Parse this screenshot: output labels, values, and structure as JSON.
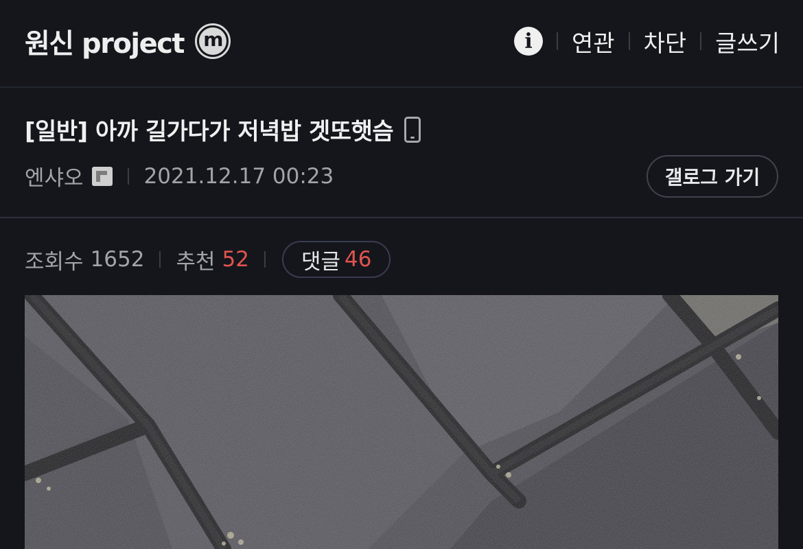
{
  "header": {
    "gallery_name": "원신 project",
    "minor_badge": "m",
    "info_icon": "info-icon",
    "actions": [
      "연관",
      "차단",
      "글쓰기"
    ]
  },
  "post": {
    "title": "[일반] 아까 길가다가 저녁밥 겟또햇슴",
    "device_icon": "mobile-phone-icon",
    "author": "엔샤오",
    "author_icon": "fixed-nickname-icon",
    "datetime": "2021.12.17 00:23",
    "gallog_label": "갤로그 가기"
  },
  "stats": {
    "views_label": "조회수",
    "views": "1652",
    "recommend_label": "추천",
    "recommend": "52",
    "comments_label": "댓글",
    "comments": "46"
  },
  "colors": {
    "background": "#14161b",
    "accent_red": "#e0544f"
  }
}
